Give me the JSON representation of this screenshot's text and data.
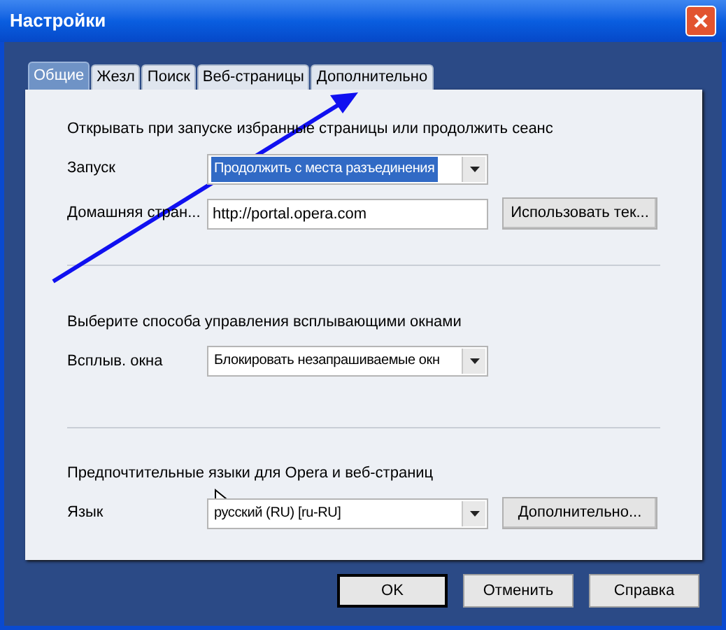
{
  "window": {
    "title": "Настройки"
  },
  "tabs": [
    {
      "label": "Общие",
      "selected": true
    },
    {
      "label": "Жезл",
      "selected": false
    },
    {
      "label": "Поиск",
      "selected": false
    },
    {
      "label": "Веб-страницы",
      "selected": false
    },
    {
      "label": "Дополнительно",
      "selected": false
    }
  ],
  "sections": [
    {
      "heading": "Открывать при запуске избранные страницы или продолжить сеанс",
      "rows": [
        {
          "kind": "select",
          "label": "Запуск",
          "value": "Продолжить с места разъединения",
          "focused": true
        },
        {
          "kind": "input",
          "label": "Домашняя стран...",
          "value": "http://portal.opera.com",
          "button": "Использовать тек..."
        }
      ]
    },
    {
      "heading": "Выберите способа управления всплывающими окнами",
      "rows": [
        {
          "kind": "select",
          "label": "Всплыв. окна",
          "value": "Блокировать незапрашиваемые окн",
          "focused": false
        }
      ]
    },
    {
      "heading": "Предпочтительные языки для Opera и веб-страниц",
      "rows": [
        {
          "kind": "select",
          "label": "Язык",
          "value": "русский (RU) [ru-RU]",
          "focused": false,
          "button": "Дополнительно..."
        }
      ]
    }
  ],
  "buttons": [
    {
      "label": "OK",
      "default": true
    },
    {
      "label": "Отменить",
      "default": false
    },
    {
      "label": "Справка",
      "default": false
    }
  ]
}
